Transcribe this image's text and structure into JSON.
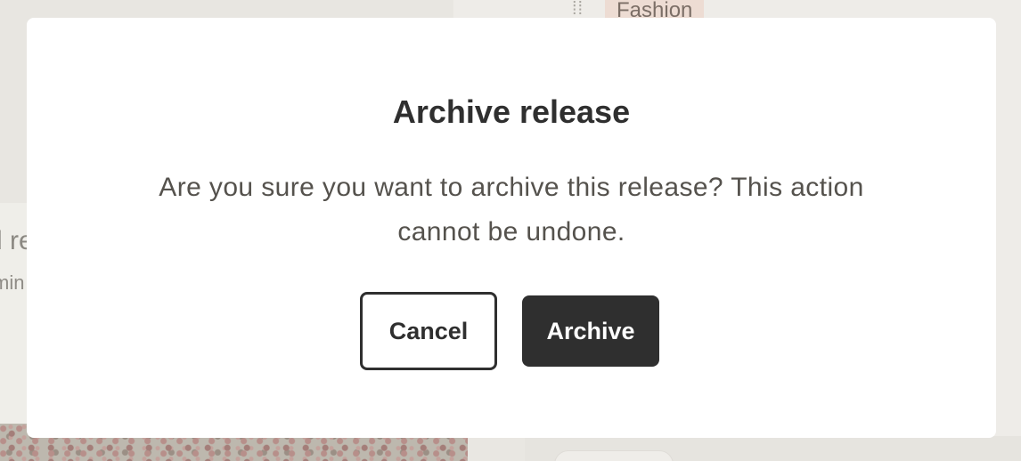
{
  "background": {
    "tag_label": "Fashion",
    "drag_handle_glyph": "⁞⁞",
    "card_title": "d re",
    "card_subtitle": "min"
  },
  "modal": {
    "title": "Archive release",
    "message": "Are you sure you want to archive this release? This action cannot be undone.",
    "cancel_label": "Cancel",
    "confirm_label": "Archive"
  },
  "colors": {
    "confirm_button": "#2f2f2f",
    "modal_background": "#ffffff",
    "page_background": "#e9e7e2"
  }
}
